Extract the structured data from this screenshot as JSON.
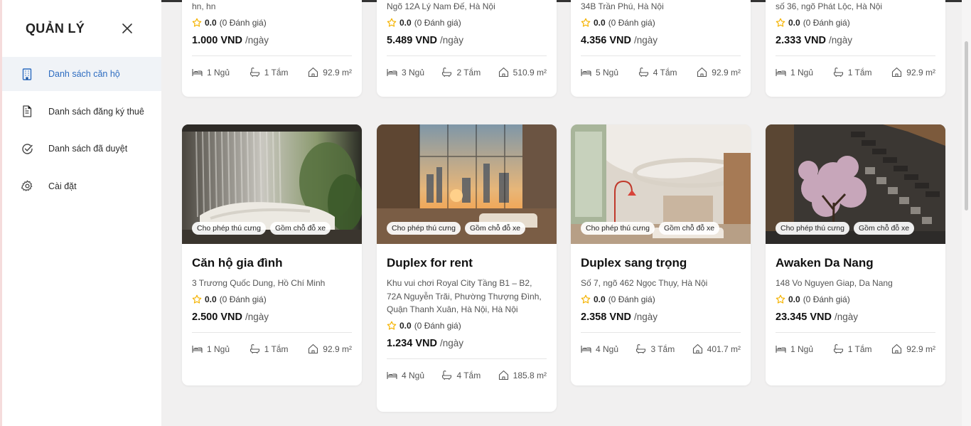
{
  "sidebar": {
    "title": "QUẢN LÝ",
    "items": [
      {
        "label": "Danh sách căn hộ",
        "icon": "building-icon",
        "active": true
      },
      {
        "label": "Danh sách đăng ký thuê",
        "icon": "document-icon",
        "active": false
      },
      {
        "label": "Danh sách đã duyệt",
        "icon": "check-circle-icon",
        "active": false
      },
      {
        "label": "Cài đặt",
        "icon": "gear-icon",
        "active": false
      }
    ]
  },
  "colors": {
    "accent": "#2d6cc0",
    "star": "#f5b301",
    "page_bg": "#f1f0f0"
  },
  "top_cards": [
    {
      "addr": "hn, hn",
      "rating": "0.0",
      "reviews": "(0 Đánh giá)",
      "price": "1.000 VND",
      "unit": "/ngày",
      "beds": "1 Ngủ",
      "baths": "1 Tắm",
      "area": "92.9 m²"
    },
    {
      "addr": "Ngõ 12A Lý Nam Đế, Hà Nội",
      "rating": "0.0",
      "reviews": "(0 Đánh giá)",
      "price": "5.489 VND",
      "unit": "/ngày",
      "beds": "3 Ngủ",
      "baths": "2 Tắm",
      "area": "510.9 m²"
    },
    {
      "addr": "34B Trần Phú, Hà Nội",
      "rating": "0.0",
      "reviews": "(0 Đánh giá)",
      "price": "4.356 VND",
      "unit": "/ngày",
      "beds": "5 Ngủ",
      "baths": "4 Tắm",
      "area": "92.9 m²"
    },
    {
      "addr": "số 36, ngõ Phát Lộc, Hà Nội",
      "rating": "0.0",
      "reviews": "(0 Đánh giá)",
      "price": "2.333 VND",
      "unit": "/ngày",
      "beds": "1 Ngủ",
      "baths": "1 Tắm",
      "area": "92.9 m²"
    }
  ],
  "cards": [
    {
      "name": "Căn hộ gia đình",
      "addr": "3 Trương Quốc Dung, Hồ Chí Minh",
      "tag1": "Cho phép thú cưng",
      "tag2": "Gồm chỗ đỗ xe",
      "rating": "0.0",
      "reviews": "(0 Đánh giá)",
      "price": "2.500 VND",
      "unit": "/ngày",
      "beds": "1 Ngủ",
      "baths": "1 Tắm",
      "area": "92.9 m²"
    },
    {
      "name": "Duplex for rent",
      "addr": "Khu vui chơi Royal City Tầng B1 – B2, 72A Nguyễn Trãi, Phường Thượng Đình, Quận Thanh Xuân, Hà Nội, Hà Nội",
      "tag1": "Cho phép thú cưng",
      "tag2": "Gồm chỗ đỗ xe",
      "rating": "0.0",
      "reviews": "(0 Đánh giá)",
      "price": "1.234 VND",
      "unit": "/ngày",
      "beds": "4 Ngủ",
      "baths": "4 Tắm",
      "area": "185.8 m²"
    },
    {
      "name": "Duplex sang trọng",
      "addr": "Số 7, ngõ 462 Ngọc Thụy, Hà Nội",
      "tag1": "Cho phép thú cưng",
      "tag2": "Gồm chỗ đỗ xe",
      "rating": "0.0",
      "reviews": "(0 Đánh giá)",
      "price": "2.358 VND",
      "unit": "/ngày",
      "beds": "4 Ngủ",
      "baths": "3 Tắm",
      "area": "401.7 m²"
    },
    {
      "name": "Awaken Da Nang",
      "addr": "148 Vo Nguyen Giap, Da Nang",
      "tag1": "Cho phép thú cưng",
      "tag2": "Gồm chỗ đỗ xe",
      "rating": "0.0",
      "reviews": "(0 Đánh giá)",
      "price": "23.345 VND",
      "unit": "/ngày",
      "beds": "1 Ngủ",
      "baths": "1 Tắm",
      "area": "92.9 m²"
    }
  ]
}
